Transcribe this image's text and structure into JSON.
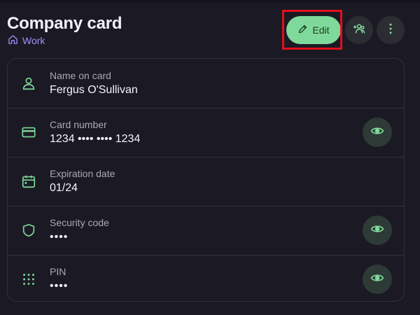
{
  "header": {
    "title": "Company card",
    "vault": "Work",
    "edit_label": "Edit"
  },
  "colors": {
    "accent_green": "#7fd99a",
    "vault_purple": "#a98cff",
    "highlight_red": "#e0101b"
  },
  "fields": [
    {
      "label": "Name on card",
      "value": "Fergus O'Sullivan",
      "icon": "user-icon"
    },
    {
      "label": "Card number",
      "value": "1234 •••• •••• 1234",
      "icon": "credit-card-icon"
    },
    {
      "label": "Expiration date",
      "value": "01/24",
      "icon": "calendar-icon"
    },
    {
      "label": "Security code",
      "value": "••••",
      "icon": "shield-icon"
    },
    {
      "label": "PIN",
      "value": "••••",
      "icon": "keypad-icon"
    }
  ]
}
